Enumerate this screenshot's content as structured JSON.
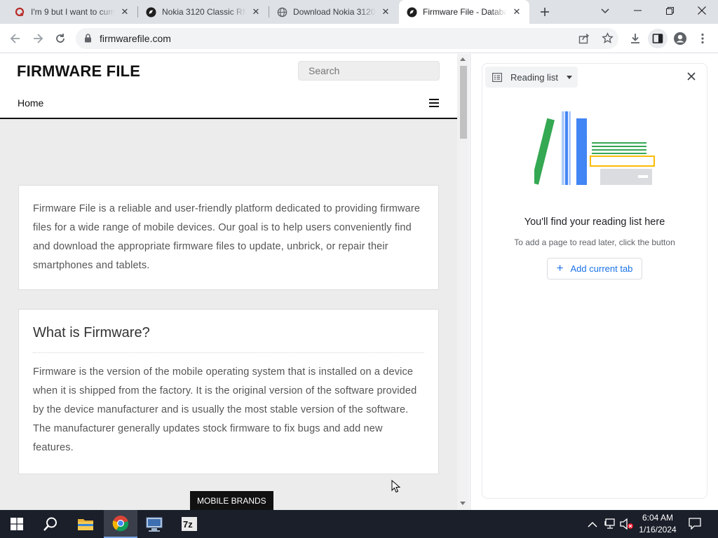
{
  "tabs": [
    {
      "title": "I'm 9 but I want to cum",
      "favicon": "quora-icon",
      "active": false
    },
    {
      "title": "Nokia 3120 Classic RM-",
      "favicon": "site-icon",
      "active": false
    },
    {
      "title": "Download Nokia 3120",
      "favicon": "globe-icon",
      "active": false
    },
    {
      "title": "Firmware File - Databa",
      "favicon": "site-icon",
      "active": true
    }
  ],
  "address_bar": {
    "url": "firmwarefile.com"
  },
  "page": {
    "logo": "FIRMWARE FILE",
    "search_placeholder": "Search",
    "nav_home": "Home",
    "intro": "Firmware File is a reliable and user-friendly platform dedicated to providing firmware files for a wide range of mobile devices. Our goal is to help users conveniently find and download the appropriate firmware files to update, unbrick, or repair their smartphones and tablets.",
    "section_title": "What is Firmware?",
    "section_body": "Firmware is the version of the mobile operating system that is installed on a device when it is shipped from the factory. It is the original version of the software provided by the device manufacturer and is usually the most stable version of the software. The manufacturer generally updates stock firmware to fix bugs and add new features.",
    "floating_label": "MOBILE BRANDS"
  },
  "side_panel": {
    "dropdown_label": "Reading list",
    "title": "You'll find your reading list here",
    "description": "To add a page to read later, click the button",
    "add_button": "Add current tab"
  },
  "taskbar": {
    "time": "6:04 AM",
    "date": "1/16/2024"
  },
  "colors": {
    "tab_strip": "#dee1e6",
    "accent_blue": "#1a73e8",
    "taskbar": "#1b1f2a"
  }
}
